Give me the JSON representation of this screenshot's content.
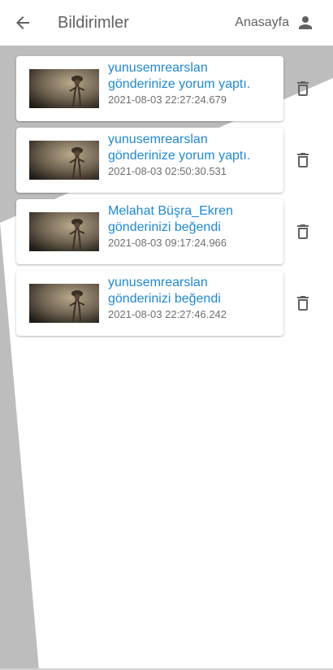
{
  "appbar": {
    "title": "Bildirimler",
    "home_label": "Anasayfa",
    "back_icon": "arrow-left-icon",
    "home_icon": "person-icon"
  },
  "colors": {
    "link_text": "#1e88d4",
    "secondary_text": "#6f6f6f",
    "background_gray": "#bdbdbd"
  },
  "notifications": [
    {
      "line1": "yunusemrearslan",
      "line2": "gönderinize yorum yaptı.",
      "time": "2021-08-03 22:27:24.679"
    },
    {
      "line1": "yunusemrearslan",
      "line2": "gönderinize yorum yaptı.",
      "time": "2021-08-03 02:50:30.531"
    },
    {
      "line1": "Melahat Büşra_Ekren",
      "line2": "gönderinizi beğendi",
      "time": "2021-08-03 09:17:24.966"
    },
    {
      "line1": "yunusemrearslan",
      "line2": "gönderinizi beğendi",
      "time": "2021-08-03 22:27:46.242"
    }
  ]
}
